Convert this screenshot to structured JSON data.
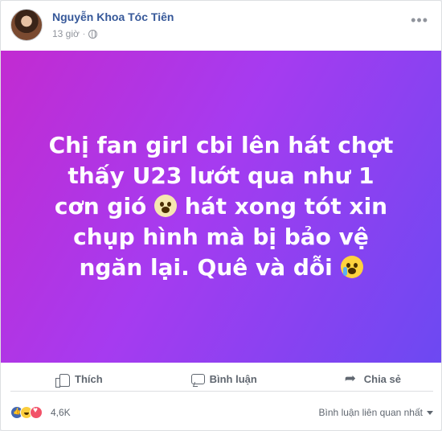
{
  "post": {
    "author": "Nguyễn Khoa Tóc Tiên",
    "time": "13 giờ",
    "separator": "·",
    "text_parts": [
      "Chị fan girl cbi lên hát chợt thấy U23 lướt qua như 1 cơn gió ",
      " hát xong tót xin chụp hình mà bị bảo vệ ngăn lại. Quê và dỗi "
    ],
    "background_gradient": [
      "#c22bd1",
      "#a63bf0",
      "#6c49f2"
    ]
  },
  "actions": {
    "like": "Thích",
    "comment": "Bình luận",
    "share": "Chia sẻ"
  },
  "footer": {
    "reaction_count": "4,6K",
    "sort_label": "Bình luận liên quan nhất"
  },
  "icons": [
    "more-icon",
    "globe-icon",
    "like-icon",
    "comment-icon",
    "share-icon",
    "screaming-face-icon",
    "crying-face-icon"
  ]
}
